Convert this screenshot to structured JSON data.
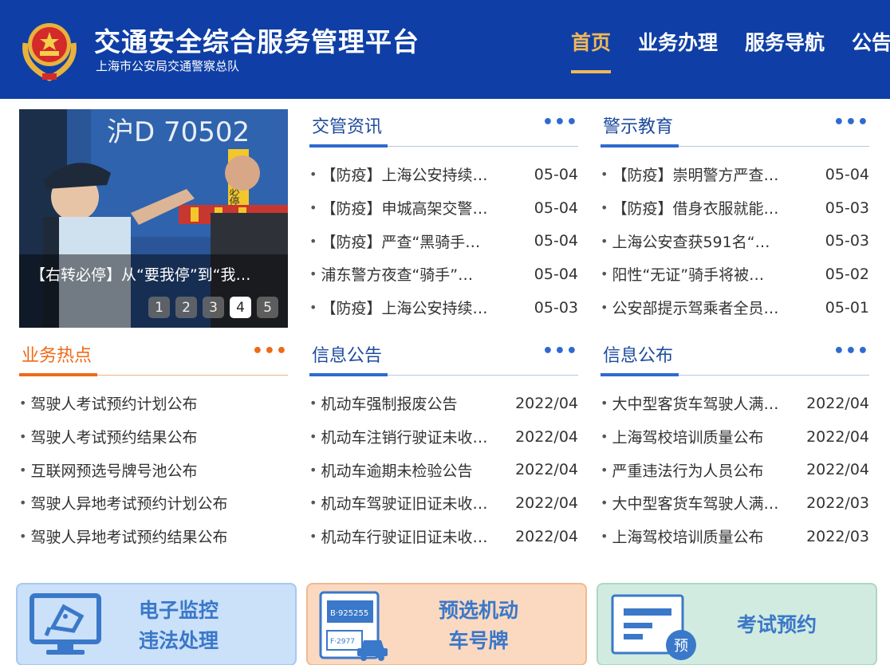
{
  "header": {
    "title": "交通安全综合服务管理平台",
    "subtitle": "上海市公安局交通警察总队",
    "nav": [
      {
        "label": "首页",
        "active": true
      },
      {
        "label": "业务办理",
        "active": false
      },
      {
        "label": "服务导航",
        "active": false
      },
      {
        "label": "公告",
        "active": false
      }
    ]
  },
  "carousel": {
    "caption": "【右转必停】从“要我停”到“我…",
    "photo_plate_text": "沪D 70502",
    "photo_sign_text": "右转必停",
    "pages": [
      "1",
      "2",
      "3",
      "4",
      "5"
    ],
    "active_page": 4
  },
  "panels": {
    "news": {
      "title": "交管资讯",
      "more": "•••",
      "items": [
        {
          "text": "【防疫】上海公安持续…",
          "date": "05-04"
        },
        {
          "text": "【防疫】申城高架交警…",
          "date": "05-04"
        },
        {
          "text": "【防疫】严查“黑骑手…",
          "date": "05-04"
        },
        {
          "text": "浦东警方夜查“骑手”…",
          "date": "05-04"
        },
        {
          "text": "【防疫】上海公安持续…",
          "date": "05-03"
        }
      ]
    },
    "warning": {
      "title": "警示教育",
      "more": "•••",
      "items": [
        {
          "text": "【防疫】崇明警方严查…",
          "date": "05-04"
        },
        {
          "text": "【防疫】借身衣服就能…",
          "date": "05-03"
        },
        {
          "text": "上海公安查获591名“…",
          "date": "05-03"
        },
        {
          "text": "阳性“无证”骑手将被…",
          "date": "05-02"
        },
        {
          "text": "公安部提示驾乘者全员…",
          "date": "05-01"
        }
      ]
    },
    "hot": {
      "title": "业务热点",
      "more": "•••",
      "items": [
        {
          "text": "驾驶人考试预约计划公布"
        },
        {
          "text": "驾驶人考试预约结果公布"
        },
        {
          "text": "互联网预选号牌号池公布"
        },
        {
          "text": "驾驶人异地考试预约计划公布"
        },
        {
          "text": "驾驶人异地考试预约结果公布"
        }
      ]
    },
    "notice": {
      "title": "信息公告",
      "more": "•••",
      "items": [
        {
          "text": "机动车强制报废公告",
          "date": "2022/04"
        },
        {
          "text": "机动车注销行驶证未收…",
          "date": "2022/04"
        },
        {
          "text": "机动车逾期未检验公告",
          "date": "2022/04"
        },
        {
          "text": "机动车驾驶证旧证未收…",
          "date": "2022/04"
        },
        {
          "text": "机动车行驶证旧证未收…",
          "date": "2022/04"
        }
      ]
    },
    "publish": {
      "title": "信息公布",
      "more": "•••",
      "items": [
        {
          "text": "大中型客货车驾驶人满…",
          "date": "2022/04"
        },
        {
          "text": "上海驾校培训质量公布",
          "date": "2022/04"
        },
        {
          "text": "严重违法行为人员公布",
          "date": "2022/04"
        },
        {
          "text": "大中型客货车驾驶人满…",
          "date": "2022/03"
        },
        {
          "text": "上海驾校培训质量公布",
          "date": "2022/03"
        }
      ]
    }
  },
  "cards": {
    "monitor": {
      "line1": "电子监控",
      "line2": "违法处理",
      "icon": "monitor-camera-icon",
      "color": "#3a78c9"
    },
    "plate": {
      "line1": "预选机动",
      "line2": "车号牌",
      "icon": "license-plate-icon",
      "color": "#3a78c9",
      "plate1": "B·925255",
      "plate2": "F·2977"
    },
    "exam": {
      "line1": "考试预约",
      "icon": "exam-booking-icon",
      "color": "#3a78c9",
      "badge": "预"
    }
  },
  "colors": {
    "header_bg": "#0f3fa6",
    "nav_active": "#f0b85a",
    "accent_blue": "#2f6ad0",
    "accent_orange": "#ee6a16"
  }
}
